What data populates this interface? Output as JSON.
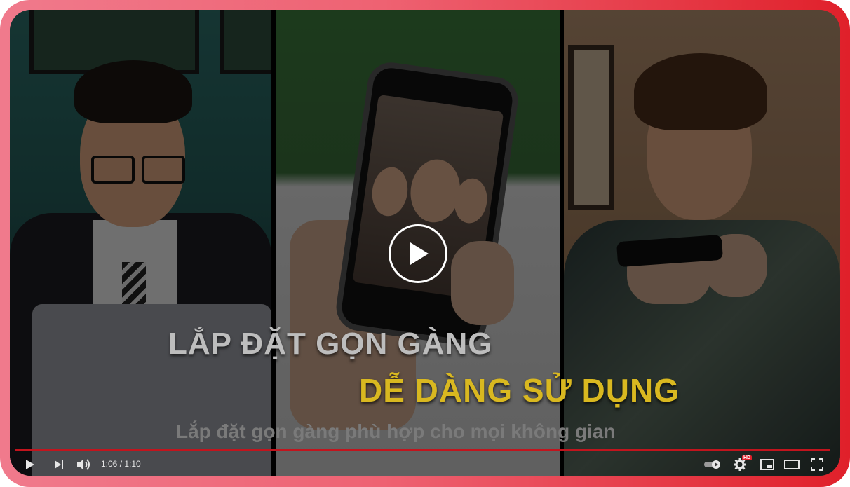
{
  "video": {
    "headline_line1": "LẮP ĐẶT GỌN GÀNG",
    "headline_line2": "DỄ DÀNG SỬ DỤNG",
    "subtitle": "Lắp đặt gọn gàng phù hợp cho mọi không gian",
    "accent_color": "#d9b820"
  },
  "player": {
    "current_time": "1:06",
    "separator": " / ",
    "duration": "1:10",
    "progress": 0.943,
    "quality_badge": "HD",
    "progress_color": "#c2141d",
    "frame_color": "#e0202a",
    "icons": [
      "play-icon",
      "next-icon",
      "volume-icon",
      "autoplay-toggle-icon",
      "settings-icon",
      "miniplayer-icon",
      "theater-icon",
      "fullscreen-icon"
    ]
  }
}
